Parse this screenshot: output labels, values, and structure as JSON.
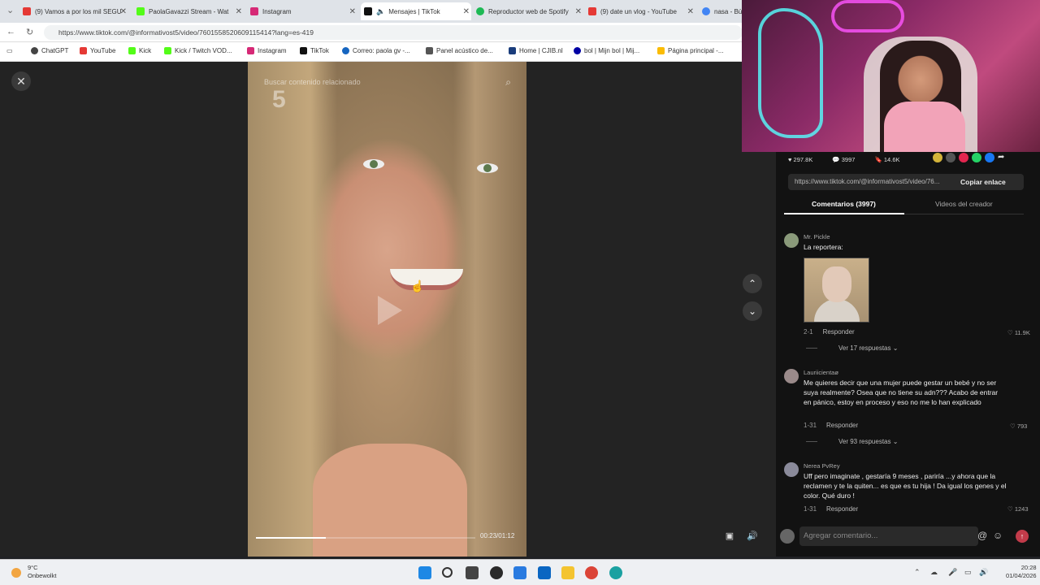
{
  "browser": {
    "tabs": [
      {
        "label": "(9) Vamos a por los mil SEGU",
        "color": "#e53935",
        "active": false
      },
      {
        "label": "PaolaGavazzi Stream - Wat",
        "color": "#53fc18",
        "active": false
      },
      {
        "label": "Instagram",
        "color": "#d62976",
        "active": false
      },
      {
        "label": "Mensajes | TikTok",
        "color": "#111111",
        "active": true
      },
      {
        "label": "Reproductor web de Spotify",
        "color": "#1db954",
        "active": false
      },
      {
        "label": "(9) date un vlog - YouTube",
        "color": "#e53935",
        "active": false
      },
      {
        "label": "nasa - Bús",
        "color": "#4285f4",
        "active": false
      }
    ],
    "url": "https://www.tiktok.com/@informativost5/video/7601558520609115414?lang=es-419",
    "bookmarks": [
      {
        "label": "ChatGPT",
        "color": "#444444"
      },
      {
        "label": "YouTube",
        "color": "#e53935"
      },
      {
        "label": "Kick",
        "color": "#53fc18"
      },
      {
        "label": "Kick / Twitch VOD...",
        "color": "#53fc18"
      },
      {
        "label": "Instagram",
        "color": "#d62976"
      },
      {
        "label": "TikTok",
        "color": "#111111"
      },
      {
        "label": "Correo: paola gv -...",
        "color": "#1565c0"
      },
      {
        "label": "Panel acústico de...",
        "color": "#555555"
      },
      {
        "label": "Home | CJIB.nl",
        "color": "#1a3d7c"
      },
      {
        "label": "bol | Mijn bol | Mij...",
        "color": "#0000a4"
      },
      {
        "label": "Página principal -...",
        "color": "#fbbc04"
      }
    ]
  },
  "player": {
    "close_icon": "close-icon",
    "search_placeholder": "Buscar contenido relacionado",
    "watermark": "5",
    "time": "00:23/01:12",
    "progress": 0.32
  },
  "panel": {
    "likes": "297.8K",
    "comments_count": "3997",
    "saves": "14.6K",
    "link": "https://www.tiktok.com/@informativost5/video/76...",
    "copy_label": "Copiar enlace",
    "tab_comments": "Comentarios (3997)",
    "tab_creator": "Videos del creador",
    "comments": [
      {
        "user": "Mr. Pickle",
        "text": "La reportera:",
        "date": "2-1",
        "reply": "Responder",
        "likes": "11.9K",
        "replies": "Ver 17 respuestas"
      },
      {
        "user": "Lauriicientaø",
        "text": "Me quieres decir que una mujer puede gestar un bebé y no ser suya realmente? Osea que no tiene su adn??? Acabo de entrar en pánico, estoy en proceso y eso no me lo han explicado",
        "date": "1-31",
        "reply": "Responder",
        "likes": "793",
        "replies": "Ver 93 respuestas"
      },
      {
        "user": "Nerea PvRey",
        "text": "Uff pero imaginate , gestaría 9 meses , pariría ...y ahora que la reclamen y te la quiten... es que es tu hija ! Da igual los genes y el color. Qué duro !",
        "date": "1-31",
        "reply": "Responder",
        "likes": "1243"
      }
    ],
    "add_comment_placeholder": "Agregar comentario..."
  },
  "taskbar": {
    "temp": "9°C",
    "weather": "Onbewolkt",
    "time": "20:28",
    "date": "01/04/2026"
  }
}
